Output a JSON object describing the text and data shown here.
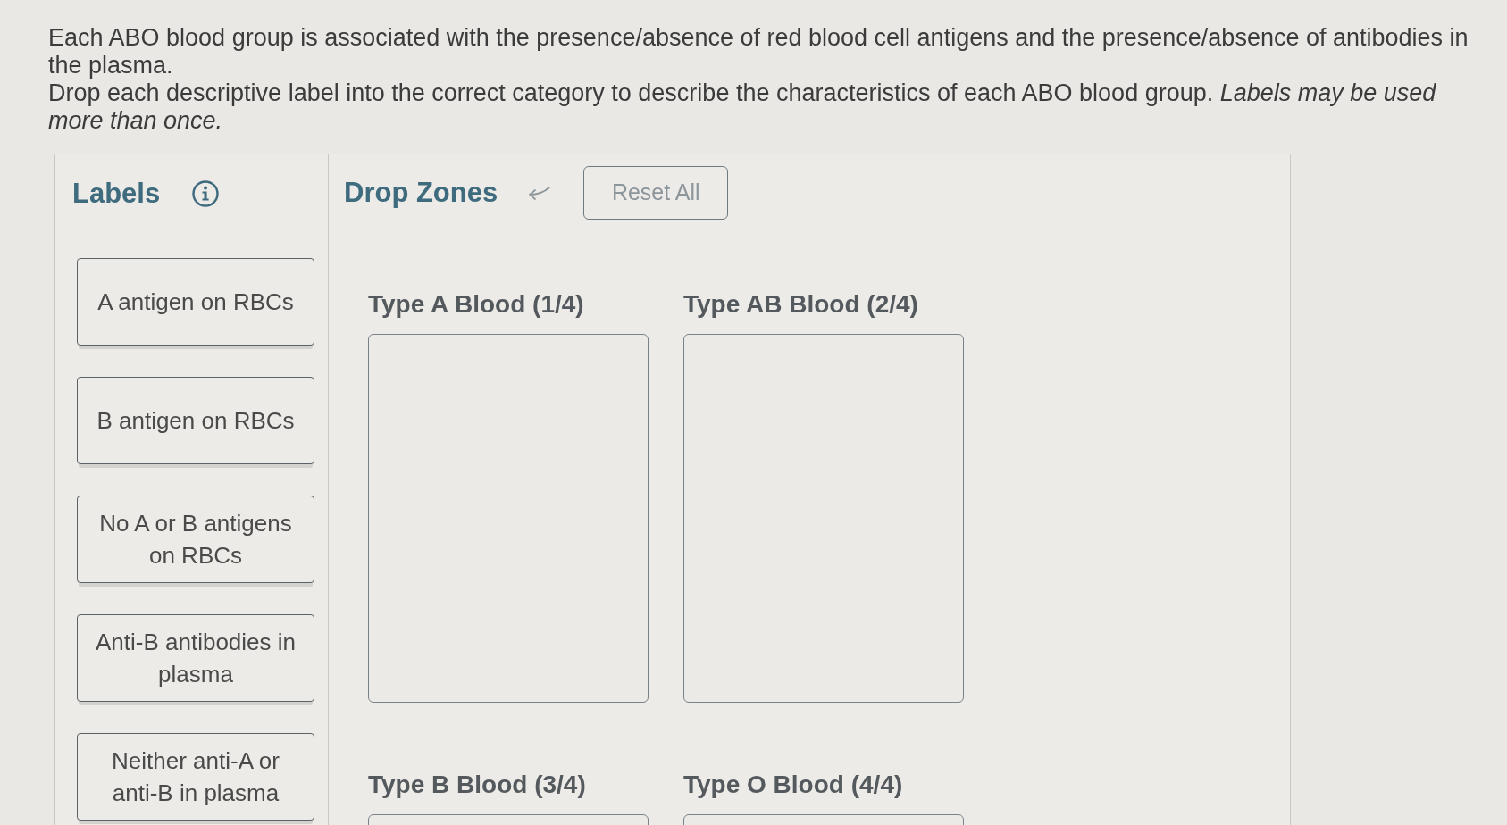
{
  "instructions": [
    "Each ABO blood group is associated with the presence/absence of red blood cell antigens and the presence/absence of antibodies in the plasma.",
    "Drop each descriptive label into the correct category to describe the characteristics of each ABO blood group. *Labels may be used more than once.*"
  ],
  "labels_panel": {
    "title": "Labels",
    "labels": [
      "A antigen on RBCs",
      "B antigen on RBCs",
      "No A or B antigens on RBCs",
      "Anti-B antibodies in plasma",
      "Neither anti-A or anti-B in plasma"
    ]
  },
  "drop_zones_panel": {
    "title": "Drop Zones",
    "reset_button": "Reset All",
    "zones": [
      {
        "title": "Type A Blood (1/4)"
      },
      {
        "title": "Type AB Blood (2/4)"
      },
      {
        "title": "Type B Blood (3/4)"
      },
      {
        "title": "Type O Blood (4/4)"
      }
    ]
  }
}
